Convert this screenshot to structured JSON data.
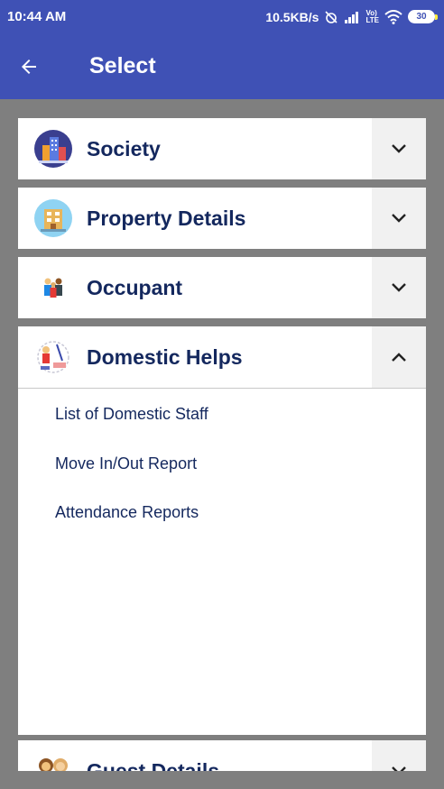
{
  "status_bar": {
    "time": "10:44 AM",
    "network_speed": "10.5KB/s",
    "lte_label": "LTE",
    "volte_label": "Vo)",
    "battery": "30"
  },
  "app_bar": {
    "title": "Select",
    "back_icon": "arrow-left-icon"
  },
  "accordion": {
    "sections": [
      {
        "label": "Society",
        "icon": "society-building-icon",
        "expanded": false
      },
      {
        "label": "Property Details",
        "icon": "property-building-icon",
        "expanded": false
      },
      {
        "label": "Occupant",
        "icon": "occupants-group-icon",
        "expanded": false
      },
      {
        "label": "Domestic Helps",
        "icon": "domestic-help-icon",
        "expanded": true
      },
      {
        "label": "Guest Details",
        "icon": "guests-icon",
        "expanded": false
      }
    ],
    "domestic_helps_items": [
      "List of Domestic Staff",
      "Move In/Out Report",
      "Attendance Reports"
    ]
  },
  "colors": {
    "primary": "#3f51b5",
    "label": "#14285e",
    "background": "#7f7f7f"
  }
}
